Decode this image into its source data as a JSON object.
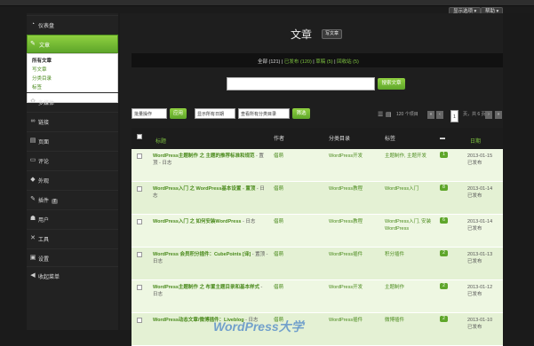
{
  "topbar": {
    "screen_options": "显示选项 ▾",
    "help": "帮助 ▾"
  },
  "sidebar": {
    "items": [
      {
        "label": "仪表盘",
        "icon": "dashboard-icon",
        "glyph": "◔"
      },
      {
        "label": "多媒体",
        "icon": "media-icon",
        "glyph": "✿"
      },
      {
        "label": "链接",
        "icon": "link-icon",
        "glyph": "∞"
      },
      {
        "label": "页面",
        "icon": "page-icon",
        "glyph": "▤"
      },
      {
        "label": "评论",
        "icon": "comment-icon",
        "glyph": "▭"
      },
      {
        "label": "外观",
        "icon": "appearance-icon",
        "glyph": "◆"
      },
      {
        "label": "插件",
        "icon": "plugin-icon",
        "glyph": "✎",
        "badge": "7"
      },
      {
        "label": "用户",
        "icon": "users-icon",
        "glyph": "☗"
      },
      {
        "label": "工具",
        "icon": "tools-icon",
        "glyph": "✕"
      },
      {
        "label": "设置",
        "icon": "settings-icon",
        "glyph": "▣"
      },
      {
        "label": "收起菜单",
        "icon": "collapse-icon",
        "glyph": "◀"
      }
    ],
    "active": {
      "label": "文章",
      "icon": "pin-icon",
      "glyph": "✎"
    },
    "submenu": [
      "所有文章",
      "写文章",
      "分类目录",
      "标签"
    ]
  },
  "page": {
    "title": "文章",
    "write_button": "写文章"
  },
  "filters": {
    "all": "全部",
    "all_count": "(121)",
    "published": "已发布",
    "published_count": "(120)",
    "drafts": "草稿",
    "drafts_count": "(5)",
    "trash": "回收站",
    "trash_count": "(5)"
  },
  "search": {
    "value": "",
    "button": "搜索文章"
  },
  "toolbar": {
    "bulk_select": "批量操作",
    "apply": "应用",
    "date_select": "显示所有日期",
    "category_select": "查看所有分类目录",
    "filter": "筛选",
    "items_count": "120 个项目",
    "first": "«",
    "prev": "‹",
    "current_page": "1",
    "pages_text": "页，共 6 页",
    "next": "›",
    "last": "»"
  },
  "table": {
    "headers": {
      "title": "标题",
      "author": "作者",
      "category": "分类目录",
      "tags": "标签",
      "date": "日期"
    },
    "rows": [
      {
        "title": "WordPress主题制作 之 主题的推荐标准和规范",
        "suffix": " - 置顶 - 日志",
        "author": "倡萌",
        "category": "WordPress开发",
        "tags": "主题制作, 主题开发",
        "comments": "1",
        "date": "2013-01-15",
        "status": "已发布"
      },
      {
        "title": "WordPress入门 之 WordPress基本设置 - 置顶",
        "suffix": " - 日志",
        "author": "倡萌",
        "category": "WordPress教程",
        "tags": "WordPress入门",
        "comments": "8",
        "date": "2013-01-14",
        "status": "已发布"
      },
      {
        "title": "WordPress入门 之 如何安装WordPress",
        "suffix": " - 日志",
        "author": "倡萌",
        "category": "WordPress教程",
        "tags": "WordPress入门, 安装WordPress",
        "comments": "6",
        "date": "2013-01-14",
        "status": "已发布"
      },
      {
        "title": "WordPress 会员积分插件：CubePoints [译]",
        "suffix": " - 置顶 - 日志",
        "author": "倡萌",
        "category": "WordPress插件",
        "tags": "积分插件",
        "comments": "2",
        "date": "2013-01-13",
        "status": "已发布"
      },
      {
        "title": "WordPress主题制作 之 布置主题目录和基本样式",
        "suffix": " - 日志",
        "author": "倡萌",
        "category": "WordPress开发",
        "tags": "主题制作",
        "comments": "2",
        "date": "2013-01-12",
        "status": "已发布"
      },
      {
        "title": "WordPress动态文章/微博插件：Liveblog",
        "suffix": " - 日志",
        "author": "倡萌",
        "category": "WordPress插件",
        "tags": "微博插件",
        "comments": "2",
        "date": "2013-01-10",
        "status": "已发布"
      }
    ]
  },
  "watermark": "WordPress大学"
}
